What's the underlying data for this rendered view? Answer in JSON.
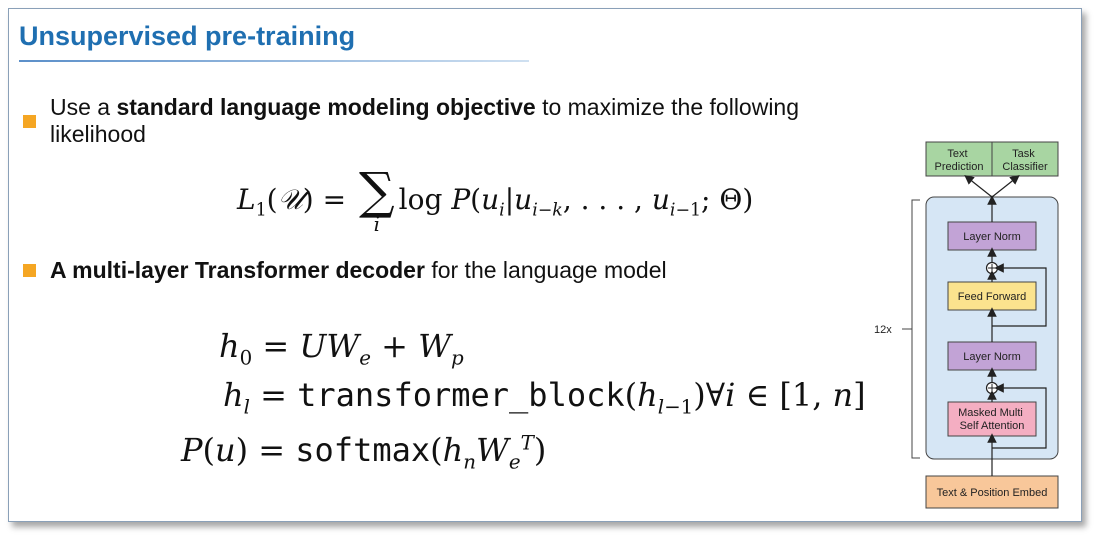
{
  "slide": {
    "title": "Unsupervised pre-training",
    "bullet1": {
      "pre": "Use a ",
      "bold": "standard language modeling objective",
      "post": " to maximize the following likelihood"
    },
    "eq1": "L₁(𝒰) = Σᵢ log P(uᵢ | uᵢ₋ₖ, …, uᵢ₋₁; Θ)",
    "bullet2": {
      "bold": "A multi-layer Transformer decoder",
      "post": " for the language model"
    },
    "eq2": "h₀ = UWₑ + Wₚ",
    "eq3": "hₗ = transformer_block(hₗ₋₁) ∀i ∈ [1, n]",
    "eq4": "P(u) = softmax(hₙ Wₑᵀ)"
  },
  "diagram": {
    "head_left": "Text\nPrediction",
    "head_right": "Task\nClassifier",
    "layer_norm_top": "Layer Norm",
    "feed_forward": "Feed Forward",
    "layer_norm_bottom": "Layer Norm",
    "attention": "Masked Multi\nSelf Attention",
    "embed": "Text & Position Embed",
    "repeat": "12x",
    "colors": {
      "head": "#a8d5a2",
      "layer_norm": "#c2a3d6",
      "feed_forward": "#fbe38e",
      "attention": "#f4aec2",
      "embed": "#f8c79a",
      "block_bg": "#d6e6f5"
    }
  }
}
